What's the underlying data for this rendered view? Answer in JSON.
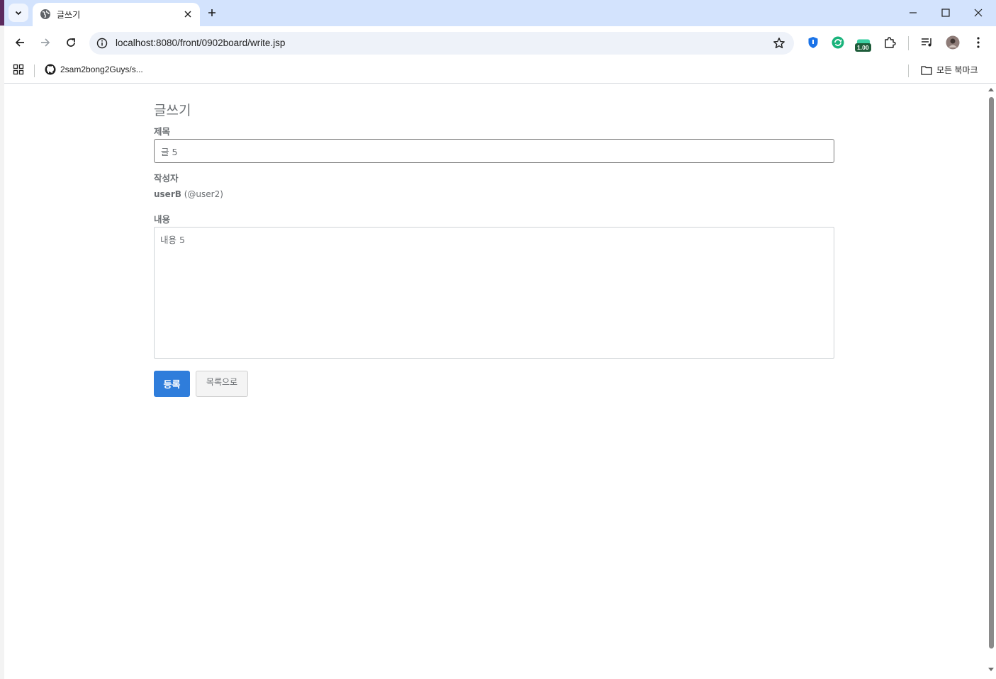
{
  "browser": {
    "tab_title": "글쓰기",
    "url": "localhost:8080/front/0902board/write.jsp",
    "extension_badge": "1.00",
    "bookmarks": [
      {
        "label": "2sam2bong2Guys/s..."
      }
    ],
    "all_bookmarks_label": "모든 북마크"
  },
  "page": {
    "heading": "글쓰기",
    "title_label": "제목",
    "title_value": "글 5",
    "author_label": "작성자",
    "author_name": "userB",
    "author_id": "(@user2)",
    "content_label": "내용",
    "content_value": "내용 5",
    "submit_label": "등록",
    "list_label": "목록으로"
  },
  "colors": {
    "tabstrip": "#d3e3fd",
    "primary_button": "#2f7ddb",
    "label_text": "#6b6f73"
  }
}
